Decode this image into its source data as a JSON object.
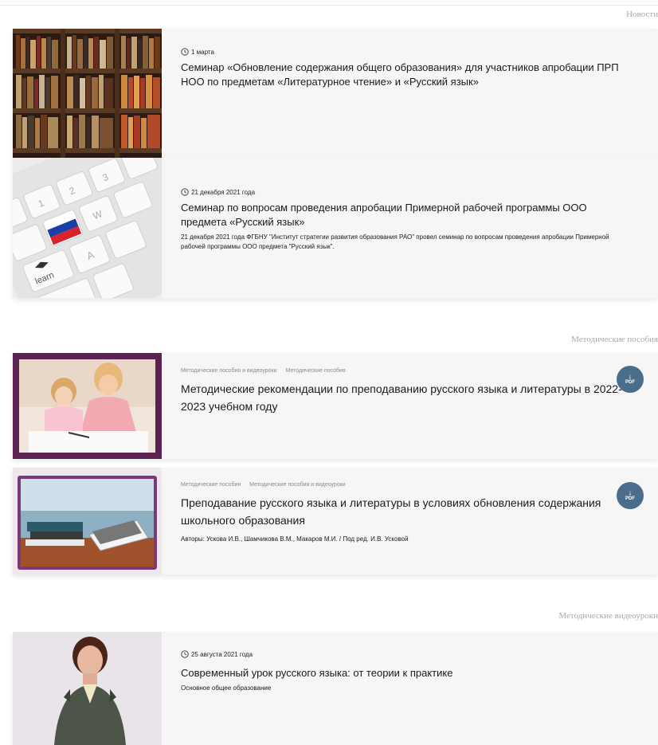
{
  "sections": {
    "news": {
      "title": "Новости"
    },
    "methods": {
      "title": "Методические пособия"
    },
    "video": {
      "title": "Методические видеоуроки"
    }
  },
  "news": [
    {
      "date": "1 марта",
      "title": "Семинар «Обновление содержания общего образования» для участников апробации ПРП НОО по предметам «Литературное чтение» и «Русский язык»",
      "image": "bookshelf-photo"
    },
    {
      "date": "21 декабря 2021 года",
      "title": "Семинар по вопросам проведения апробации Примерной рабочей программы ООО предмета «Русский язык»",
      "description": "21 декабря 2021 года ФГБНУ \"Институт стратегии развития образования РАО\" провел семинар по вопросам проведения апробации Примерной рабочей программы ООО предмета \"Русский язык\".",
      "image": "keyboard-flag-photo",
      "key_labels": {
        "learn": "learn",
        "a": "A",
        "w": "W",
        "two": "2",
        "three": "3",
        "one": "1"
      }
    }
  ],
  "methods": [
    {
      "tags": [
        "Методические пособия и видеоуроки",
        "Методические пособия"
      ],
      "title": "Методические рекомендации по преподаванию русского языка и литературы в 2022-2023 учебном году",
      "pdf_label": "PDF",
      "image": "mother-child-photo"
    },
    {
      "tags": [
        "Методические пособия",
        "Методические пособия и видеоуроки"
      ],
      "title": "Преподавание русского языка и литературы в условиях обновления содержания школьного образования",
      "authors": "Авторы: Ускова И.В., Шамчикова В.М., Макаров М.И. / Под ред. И.В. Усковой",
      "pdf_label": "PDF",
      "image": "books-desk-photo"
    }
  ],
  "video": [
    {
      "date": "25 августа 2021 года",
      "title": "Современный урок русского языка: от теории к практике",
      "description": "Основное общее образование",
      "image": "teacher-video-still"
    }
  ],
  "icons": {
    "clock": "clock-icon",
    "pdf": "pdf-download-icon"
  },
  "colors": {
    "pdf_button": "#4a6d8c",
    "card_bg": "#f6f6f6",
    "section_title": "#a9a9a9"
  }
}
